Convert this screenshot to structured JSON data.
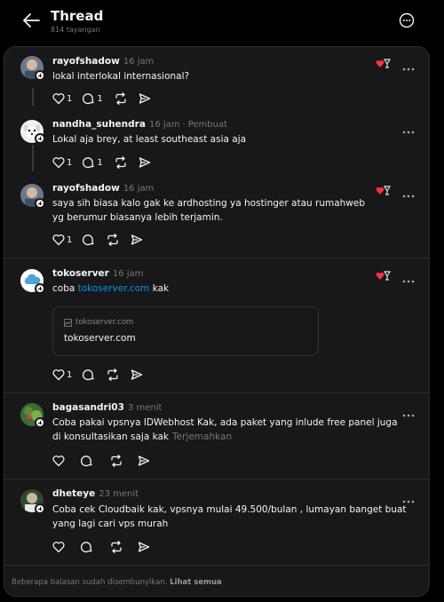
{
  "header": {
    "title": "Thread",
    "views": "814 tayangan"
  },
  "posts": [
    {
      "username": "rayofshadow",
      "time": "16 jam",
      "text": "lokal interlokal internasional?",
      "likes": "1",
      "replies": "1"
    },
    {
      "username": "nandha_suhendra",
      "time": "16 jam",
      "author_tag": "Pembuat",
      "text": "Lokal aja brey, at least southeast asia aja",
      "likes": "1",
      "replies": "1"
    },
    {
      "username": "rayofshadow",
      "time": "16 jam",
      "text": "saya sih biasa kalo gak ke ardhosting ya hostinger atau rumahweb yg berumur biasanya lebih terjamin.",
      "likes": "1"
    },
    {
      "username": "tokoserver",
      "time": "16 jam",
      "text_before": "coba ",
      "link": "tokoserver.com",
      "text_after": " kak",
      "preview_domain": "tokoserver.com",
      "preview_title": "tokoserver.com",
      "likes": "1"
    },
    {
      "username": "bagasandri03",
      "time": "3 menit",
      "text": "Coba pakai vpsnya IDWebhost Kak, ada paket yang inlude free panel juga di konsultasikan saja kak",
      "translate": "Terjemahkan"
    },
    {
      "username": "dheteye",
      "time": "23 menit",
      "text": "Coba cek Cloudbaik kak, vpsnya mulai 49.500/bulan , lumayan banget buat yang lagi cari vps murah"
    }
  ],
  "footer": {
    "text": "Beberapa balasan sudah disembunyikan.",
    "link": "Lihat semua"
  }
}
